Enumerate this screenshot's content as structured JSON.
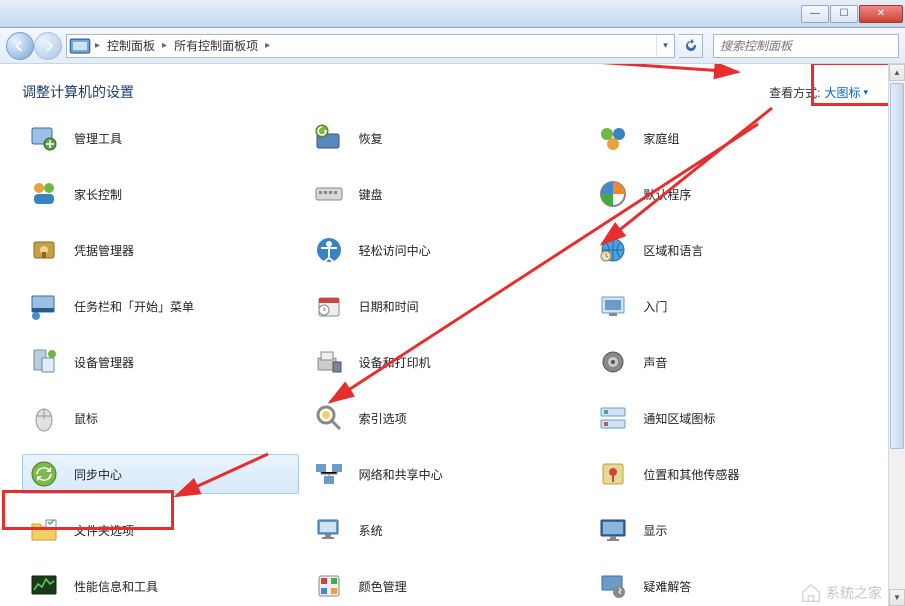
{
  "titlebar": {},
  "nav": {
    "crumb1": "控制面板",
    "crumb2": "所有控制面板项",
    "search_placeholder": "搜索控制面板"
  },
  "header": {
    "title": "调整计算机的设置",
    "view_label": "查看方式:",
    "view_value": "大图标"
  },
  "items": [
    {
      "label": "管理工具",
      "icon": "admin-tools-icon"
    },
    {
      "label": "恢复",
      "icon": "recovery-icon"
    },
    {
      "label": "家庭组",
      "icon": "homegroup-icon"
    },
    {
      "label": "家长控制",
      "icon": "parental-icon"
    },
    {
      "label": "键盘",
      "icon": "keyboard-icon"
    },
    {
      "label": "默认程序",
      "icon": "default-programs-icon"
    },
    {
      "label": "凭据管理器",
      "icon": "credential-icon"
    },
    {
      "label": "轻松访问中心",
      "icon": "ease-access-icon"
    },
    {
      "label": "区域和语言",
      "icon": "region-lang-icon"
    },
    {
      "label": "任务栏和「开始」菜单",
      "icon": "taskbar-icon"
    },
    {
      "label": "日期和时间",
      "icon": "datetime-icon"
    },
    {
      "label": "入门",
      "icon": "getting-started-icon"
    },
    {
      "label": "设备管理器",
      "icon": "device-manager-icon"
    },
    {
      "label": "设备和打印机",
      "icon": "devices-printers-icon"
    },
    {
      "label": "声音",
      "icon": "sound-icon"
    },
    {
      "label": "鼠标",
      "icon": "mouse-icon"
    },
    {
      "label": "索引选项",
      "icon": "indexing-icon"
    },
    {
      "label": "通知区域图标",
      "icon": "notification-icon"
    },
    {
      "label": "同步中心",
      "icon": "sync-center-icon",
      "selected": true
    },
    {
      "label": "网络和共享中心",
      "icon": "network-icon"
    },
    {
      "label": "位置和其他传感器",
      "icon": "location-icon"
    },
    {
      "label": "文件夹选项",
      "icon": "folder-options-icon"
    },
    {
      "label": "系统",
      "icon": "system-icon"
    },
    {
      "label": "显示",
      "icon": "display-icon"
    },
    {
      "label": "性能信息和工具",
      "icon": "performance-icon"
    },
    {
      "label": "颜色管理",
      "icon": "color-mgmt-icon"
    },
    {
      "label": "疑难解答",
      "icon": "troubleshoot-icon"
    }
  ],
  "watermark": "系统之家"
}
